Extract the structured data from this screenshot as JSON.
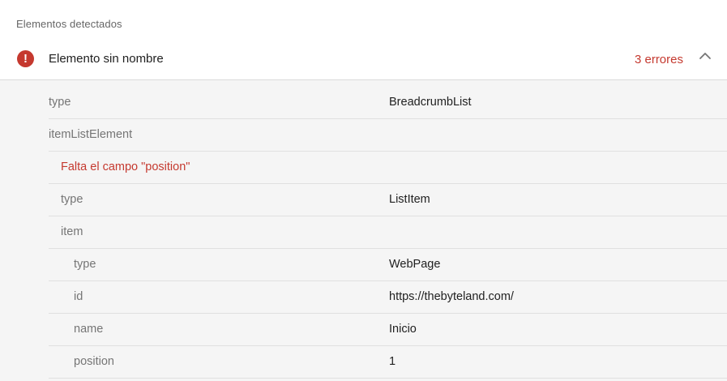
{
  "section": {
    "title": "Elementos detectados"
  },
  "item": {
    "title": "Elemento sin nombre",
    "error_count": "3 errores",
    "error_icon_glyph": "!",
    "status_color": "#c5392f"
  },
  "rows": [
    {
      "key": "type",
      "value": "BreadcrumbList"
    },
    {
      "key": "itemListElement",
      "value": ""
    },
    {
      "warning": "Falta el campo \"position\""
    },
    {
      "key": "type",
      "value": "ListItem"
    },
    {
      "key": "item",
      "value": ""
    },
    {
      "key": "type",
      "value": "WebPage"
    },
    {
      "key": "id",
      "value": "https://thebyteland.com/"
    },
    {
      "key": "name",
      "value": "Inicio"
    },
    {
      "key": "position",
      "value": "1"
    }
  ],
  "icons": {
    "error": "error-icon",
    "collapse": "chevron-up-icon"
  }
}
